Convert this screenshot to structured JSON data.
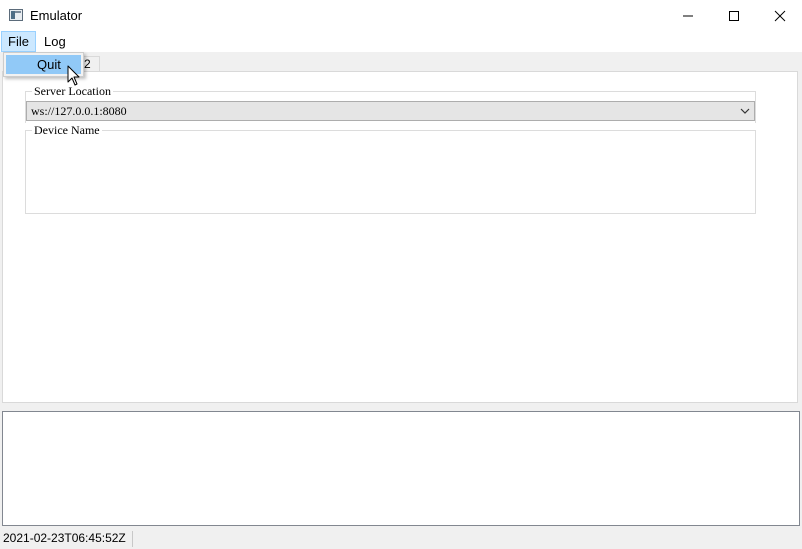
{
  "window": {
    "title": "Emulator"
  },
  "menu": {
    "file_label": "File",
    "log_label": "Log",
    "file_dropdown": [
      {
        "label": "Quit"
      }
    ]
  },
  "tabs": [
    {
      "label": "2"
    }
  ],
  "server_location": {
    "legend": "Server Location",
    "value": "ws://127.0.0.1:8080"
  },
  "device_name": {
    "legend": "Device Name"
  },
  "status_bar": {
    "timestamp": "2021-02-23T06:45:52Z"
  }
}
